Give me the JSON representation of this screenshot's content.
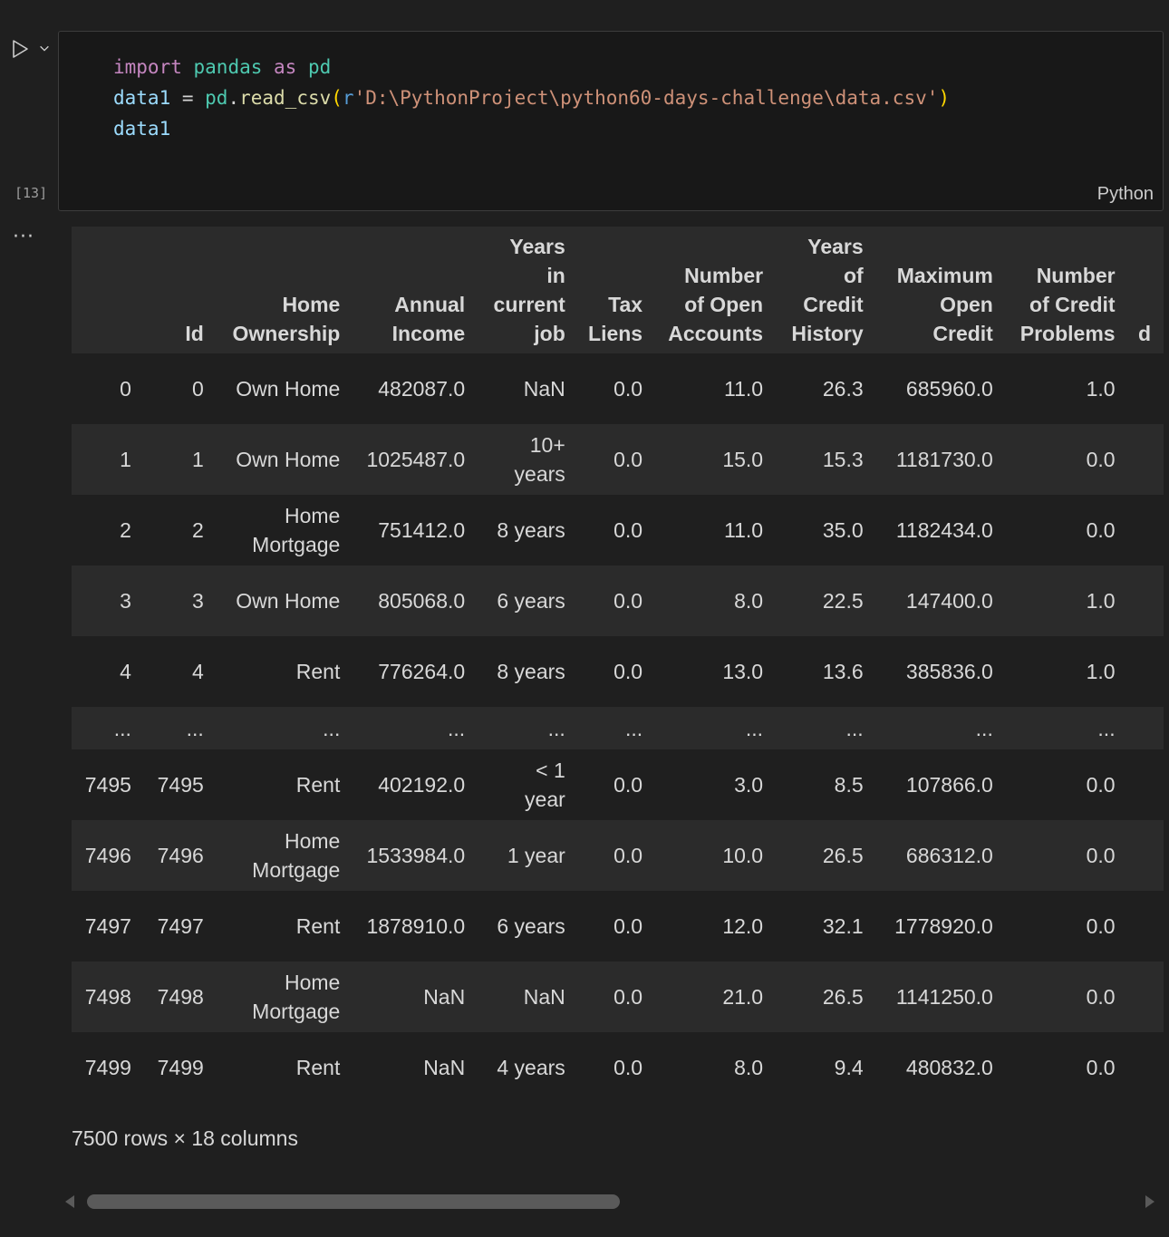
{
  "cell": {
    "execution_count": "[13]",
    "language": "Python",
    "output_menu": "···",
    "code": {
      "line1": {
        "kw": "import",
        "mod": "pandas",
        "as": "as",
        "alias": "pd"
      },
      "line2": {
        "var": "data1",
        "eq": " = ",
        "obj": "pd",
        "dot": ".",
        "fn": "read_csv",
        "open": "(",
        "prefix": "r",
        "str": "'D:\\PythonProject\\python60-days-challenge\\data.csv'",
        "close": ")"
      },
      "line3": {
        "var": "data1"
      }
    }
  },
  "table": {
    "columns": [
      [
        "",
        "",
        "",
        ""
      ],
      [
        "",
        "",
        "",
        "Id"
      ],
      [
        "",
        "",
        "Home",
        "Ownership"
      ],
      [
        "",
        "",
        "Annual",
        "Income"
      ],
      [
        "Years",
        "in",
        "current",
        "job"
      ],
      [
        "",
        "",
        "Tax",
        "Liens"
      ],
      [
        "",
        "Number",
        "of Open",
        "Accounts"
      ],
      [
        "Years",
        "of",
        "Credit",
        "History"
      ],
      [
        "",
        "Maximum",
        "Open",
        "Credit"
      ],
      [
        "",
        "Number",
        "of Credit",
        "Problems"
      ],
      [
        "",
        "",
        "",
        "d"
      ]
    ],
    "rows": [
      [
        "0",
        "0",
        [
          "Own Home"
        ],
        "482087.0",
        [
          "NaN"
        ],
        "0.0",
        "11.0",
        "26.3",
        "685960.0",
        "1.0"
      ],
      [
        "1",
        "1",
        [
          "Own Home"
        ],
        "1025487.0",
        [
          "10+",
          "years"
        ],
        "0.0",
        "15.0",
        "15.3",
        "1181730.0",
        "0.0"
      ],
      [
        "2",
        "2",
        [
          "Home",
          "Mortgage"
        ],
        "751412.0",
        [
          "8 years"
        ],
        "0.0",
        "11.0",
        "35.0",
        "1182434.0",
        "0.0"
      ],
      [
        "3",
        "3",
        [
          "Own Home"
        ],
        "805068.0",
        [
          "6 years"
        ],
        "0.0",
        "8.0",
        "22.5",
        "147400.0",
        "1.0"
      ],
      [
        "4",
        "4",
        [
          "Rent"
        ],
        "776264.0",
        [
          "8 years"
        ],
        "0.0",
        "13.0",
        "13.6",
        "385836.0",
        "1.0"
      ],
      [
        "...",
        "...",
        [
          "..."
        ],
        "...",
        [
          "..."
        ],
        "...",
        "...",
        "...",
        "...",
        "..."
      ],
      [
        "7495",
        "7495",
        [
          "Rent"
        ],
        "402192.0",
        [
          "< 1",
          "year"
        ],
        "0.0",
        "3.0",
        "8.5",
        "107866.0",
        "0.0"
      ],
      [
        "7496",
        "7496",
        [
          "Home",
          "Mortgage"
        ],
        "1533984.0",
        [
          "1 year"
        ],
        "0.0",
        "10.0",
        "26.5",
        "686312.0",
        "0.0"
      ],
      [
        "7497",
        "7497",
        [
          "Rent"
        ],
        "1878910.0",
        [
          "6 years"
        ],
        "0.0",
        "12.0",
        "32.1",
        "1778920.0",
        "0.0"
      ],
      [
        "7498",
        "7498",
        [
          "Home",
          "Mortgage"
        ],
        "NaN",
        [
          "NaN"
        ],
        "0.0",
        "21.0",
        "26.5",
        "1141250.0",
        "0.0"
      ],
      [
        "7499",
        "7499",
        [
          "Rent"
        ],
        "NaN",
        [
          "4 years"
        ],
        "0.0",
        "8.0",
        "9.4",
        "480832.0",
        "0.0"
      ]
    ],
    "summary": "7500 rows × 18 columns"
  },
  "colors": {
    "background": "#1f1f1f",
    "editor_bg": "#181818",
    "row_alt": "#2b2b2b",
    "keyword": "#c586c0",
    "module": "#4ec9b0",
    "variable": "#9cdcfe",
    "function": "#dcdcaa",
    "string": "#ce9178"
  },
  "icons": {
    "run": "play-icon",
    "run_menu": "chevron-down-icon",
    "scroll_left": "caret-left-icon",
    "scroll_right": "caret-right-icon"
  }
}
